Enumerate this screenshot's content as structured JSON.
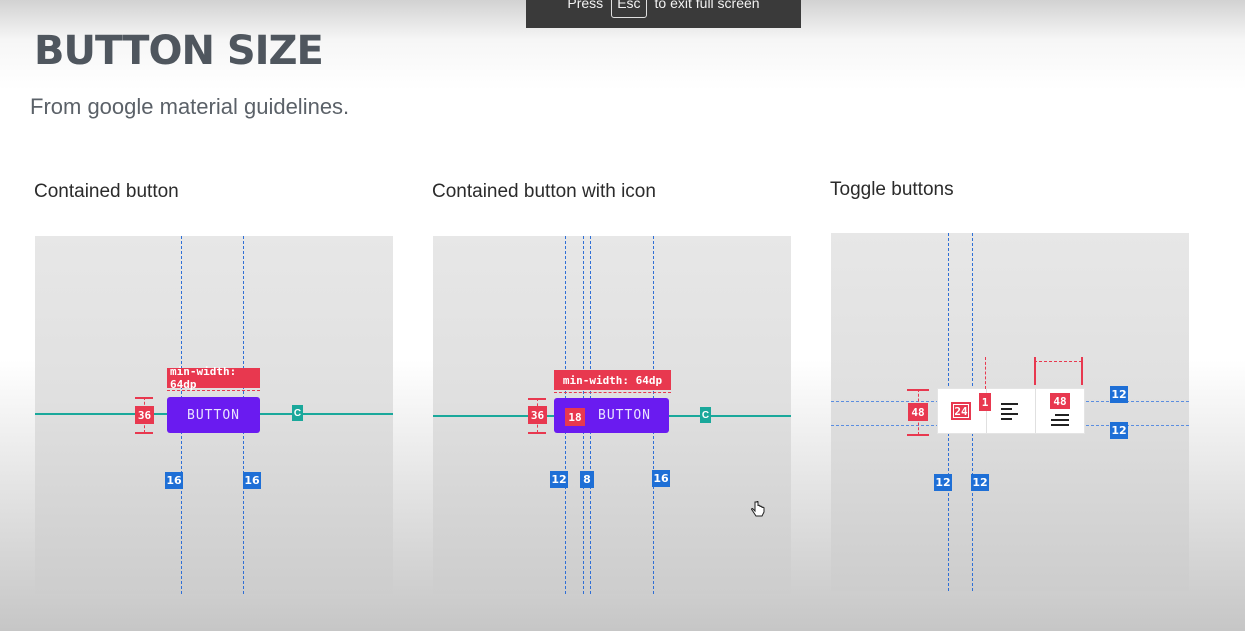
{
  "banner": {
    "press": "Press",
    "key": "Esc",
    "suffix": "to exit full screen"
  },
  "heading": {
    "title": "BUTTON SIZE",
    "subtitle": "From google material guidelines."
  },
  "panels": [
    {
      "title": "Contained button",
      "button_label": "BUTTON",
      "min_width_label": "min-width: 64dp",
      "height_tag": "36",
      "center_tag": "C",
      "padding_tags": [
        "16",
        "16"
      ]
    },
    {
      "title": "Contained button with icon",
      "button_label": "BUTTON",
      "min_width_label": "min-width: 64dp",
      "height_tag": "36",
      "icon_tag": "18",
      "center_tag": "C",
      "padding_tags": [
        "12",
        "8",
        "16"
      ]
    },
    {
      "title": "Toggle buttons",
      "height_tag": "48",
      "icon_tag": "24",
      "divider_tag": "1",
      "width_tag": "48",
      "right_tags": [
        "12",
        "12"
      ],
      "bottom_tags": [
        "12",
        "12"
      ],
      "icons": [
        "align-left-icon",
        "align-justify-icon"
      ]
    }
  ],
  "colors": {
    "button_purple": "#6a1bf0",
    "measure_red": "#e8384f",
    "measure_blue": "#1e6fd6",
    "baseline_teal": "#1aa89b"
  }
}
